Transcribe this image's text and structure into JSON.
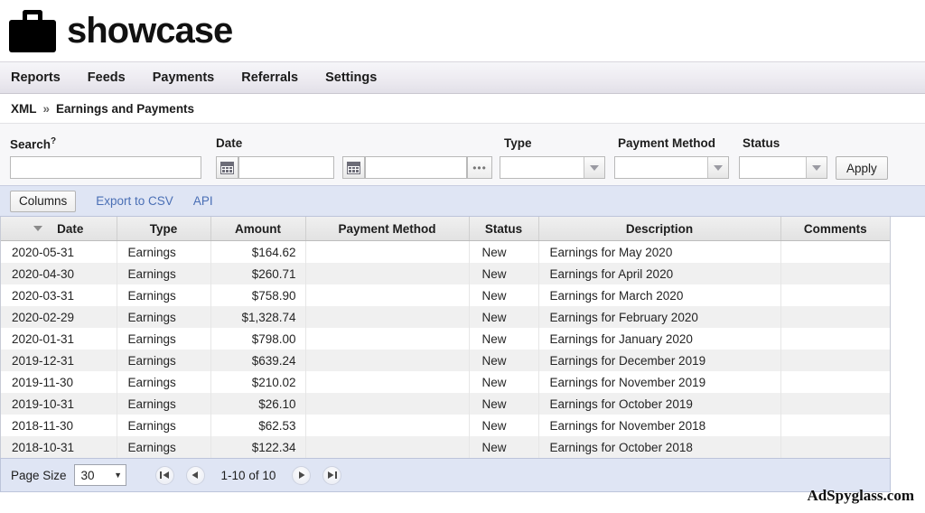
{
  "brand": {
    "logo_icon": "briefcase-icon",
    "name": "showcase"
  },
  "nav": {
    "items": [
      {
        "label": "Reports"
      },
      {
        "label": "Feeds"
      },
      {
        "label": "Payments"
      },
      {
        "label": "Referrals"
      },
      {
        "label": "Settings"
      }
    ]
  },
  "breadcrumb": {
    "root": "XML",
    "separator": "»",
    "current": "Earnings and Payments"
  },
  "filters": {
    "search": {
      "label": "Search",
      "help_marker": "?",
      "value": "",
      "placeholder": ""
    },
    "date": {
      "label": "Date",
      "from": {
        "value": "",
        "placeholder": "",
        "icon": "calendar-icon"
      },
      "to": {
        "value": "",
        "placeholder": "",
        "icon": "calendar-icon"
      },
      "more_label": "•••"
    },
    "type": {
      "label": "Type",
      "value": ""
    },
    "payment_method": {
      "label": "Payment Method",
      "value": ""
    },
    "status": {
      "label": "Status",
      "value": ""
    },
    "apply_label": "Apply"
  },
  "toolbar": {
    "columns_label": "Columns",
    "export_label": "Export to CSV",
    "api_label": "API"
  },
  "table": {
    "sort_column": "Date",
    "sort_direction": "desc",
    "columns": [
      "Date",
      "Type",
      "Amount",
      "Payment Method",
      "Status",
      "Description",
      "Comments"
    ],
    "rows": [
      {
        "date": "2020-05-31",
        "type": "Earnings",
        "amount": "$164.62",
        "payment_method": "",
        "status": "New",
        "description": "Earnings for May 2020",
        "comments": ""
      },
      {
        "date": "2020-04-30",
        "type": "Earnings",
        "amount": "$260.71",
        "payment_method": "",
        "status": "New",
        "description": "Earnings for April 2020",
        "comments": ""
      },
      {
        "date": "2020-03-31",
        "type": "Earnings",
        "amount": "$758.90",
        "payment_method": "",
        "status": "New",
        "description": "Earnings for March 2020",
        "comments": ""
      },
      {
        "date": "2020-02-29",
        "type": "Earnings",
        "amount": "$1,328.74",
        "payment_method": "",
        "status": "New",
        "description": "Earnings for February 2020",
        "comments": ""
      },
      {
        "date": "2020-01-31",
        "type": "Earnings",
        "amount": "$798.00",
        "payment_method": "",
        "status": "New",
        "description": "Earnings for January 2020",
        "comments": ""
      },
      {
        "date": "2019-12-31",
        "type": "Earnings",
        "amount": "$639.24",
        "payment_method": "",
        "status": "New",
        "description": "Earnings for December 2019",
        "comments": ""
      },
      {
        "date": "2019-11-30",
        "type": "Earnings",
        "amount": "$210.02",
        "payment_method": "",
        "status": "New",
        "description": "Earnings for November 2019",
        "comments": ""
      },
      {
        "date": "2019-10-31",
        "type": "Earnings",
        "amount": "$26.10",
        "payment_method": "",
        "status": "New",
        "description": "Earnings for October 2019",
        "comments": ""
      },
      {
        "date": "2018-11-30",
        "type": "Earnings",
        "amount": "$62.53",
        "payment_method": "",
        "status": "New",
        "description": "Earnings for November 2018",
        "comments": ""
      },
      {
        "date": "2018-10-31",
        "type": "Earnings",
        "amount": "$122.34",
        "payment_method": "",
        "status": "New",
        "description": "Earnings for October 2018",
        "comments": ""
      }
    ]
  },
  "pager": {
    "page_size_label": "Page Size",
    "page_size_value": "30",
    "status": "1-10 of 10",
    "first_icon": "first-page-icon",
    "prev_icon": "previous-page-icon",
    "next_icon": "next-page-icon",
    "last_icon": "last-page-icon"
  },
  "watermark": "AdSpyglass.com",
  "colors": {
    "toolbar_bg": "#dfe5f4",
    "link": "#4a6fb5",
    "row_alt": "#f0f0f0",
    "nav_bg": "#eceaf0"
  }
}
